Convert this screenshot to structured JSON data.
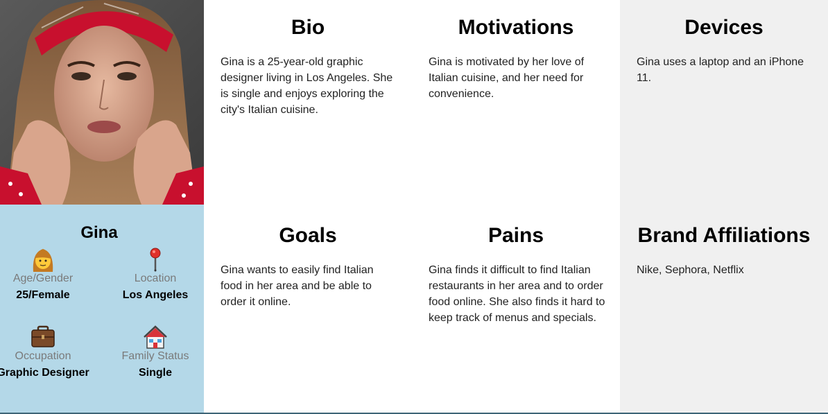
{
  "persona": {
    "name": "Gina",
    "stats": {
      "age": {
        "label": "Age/Gender",
        "value": "25/Female",
        "icon": "woman-icon"
      },
      "location": {
        "label": "Location",
        "value": "Los Angeles",
        "icon": "pin-icon"
      },
      "occupation": {
        "label": "Occupation",
        "value": "Graphic Designer",
        "icon": "briefcase-icon"
      },
      "family": {
        "label": "Family Status",
        "value": "Single",
        "icon": "house-icon"
      }
    }
  },
  "sections": {
    "bio": {
      "title": "Bio",
      "text": "Gina is a 25-year-old graphic designer living in Los Angeles. She is single and enjoys exploring the city's Italian cuisine."
    },
    "motivations": {
      "title": "Motivations",
      "text": "Gina is motivated by her love of Italian cuisine, and her need for convenience."
    },
    "devices": {
      "title": "Devices",
      "text": "Gina uses a laptop and an iPhone 11."
    },
    "goals": {
      "title": "Goals",
      "text": "Gina wants to easily find Italian food in her area and be able to order it online."
    },
    "pains": {
      "title": "Pains",
      "text": "Gina finds it difficult to find Italian restaurants in her area and to order food online. She also finds it hard to keep track of menus and specials."
    },
    "brands": {
      "title": "Brand Affiliations",
      "text": "Nike, Sephora, Netflix"
    }
  },
  "colors": {
    "profile_bg": "#b4d8e8",
    "gray_cell_bg": "#f0f0f0",
    "muted_label": "#7a7a7a"
  }
}
